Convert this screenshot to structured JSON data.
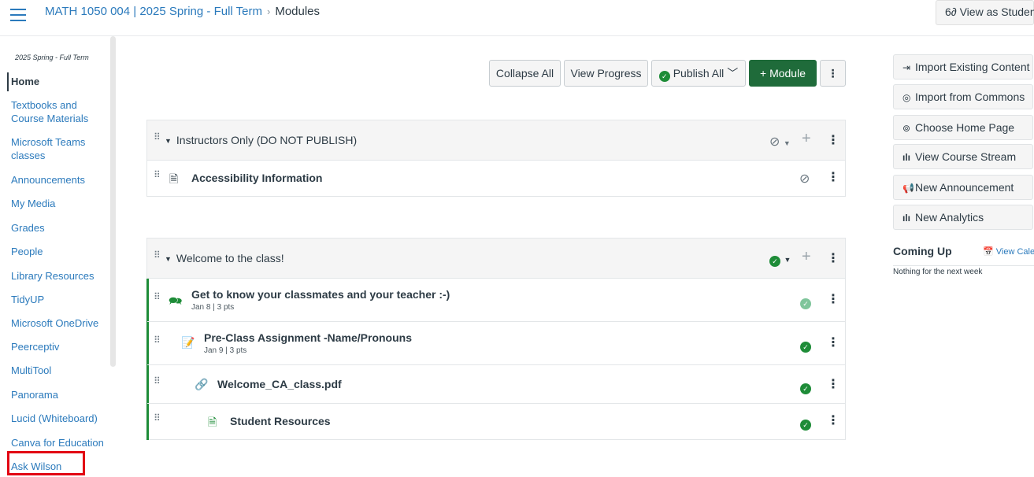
{
  "header": {
    "course": "MATH 1050 004 | 2025 Spring - Full Term",
    "separator": "›",
    "current": "Modules",
    "view_as_student": "View as Student"
  },
  "course_nav": {
    "term": "2025 Spring - Full Term",
    "items": [
      {
        "label": "Home"
      },
      {
        "label": "Textbooks and"
      },
      {
        "label": "Course Materials"
      },
      {
        "label": "Microsoft Teams"
      },
      {
        "label": "classes"
      },
      {
        "label": "Announcements"
      },
      {
        "label": "My Media"
      },
      {
        "label": "Grades"
      },
      {
        "label": "People"
      },
      {
        "label": "Library Resources"
      },
      {
        "label": "TidyUP"
      },
      {
        "label": "Microsoft OneDrive"
      },
      {
        "label": "Peerceptiv"
      },
      {
        "label": "MultiTool"
      },
      {
        "label": "Panorama"
      },
      {
        "label": "Lucid (Whiteboard)"
      },
      {
        "label": "Canva for Education"
      },
      {
        "label": "Ask Wilson"
      }
    ]
  },
  "toolbar": {
    "collapse_all": "Collapse All",
    "view_progress": "View Progress",
    "publish_all": "Publish All",
    "add_module": "+ Module",
    "more": "⋮"
  },
  "modules": [
    {
      "title": "Instructors Only (DO NOT PUBLISH)",
      "status": "unpublished",
      "items": [
        {
          "title": "Accessibility Information",
          "icon": "page-icon",
          "status": "unpublished",
          "meta": ""
        }
      ]
    },
    {
      "title": "Welcome to the class!",
      "status": "published",
      "items": [
        {
          "title": "Get to know your classmates and your teacher :-)",
          "icon": "discussion-icon",
          "status": "published-light",
          "meta": "Jan 8 | 3 pts"
        },
        {
          "title": "Pre-Class Assignment -Name/Pronouns",
          "icon": "assignment-icon",
          "status": "published",
          "meta": "Jan 9 | 3 pts"
        },
        {
          "title": "Welcome_CA_class.pdf",
          "icon": "attachment-icon",
          "status": "published",
          "meta": ""
        },
        {
          "title": "Student Resources",
          "icon": "page-icon",
          "status": "published",
          "meta": ""
        }
      ]
    }
  ],
  "sidebar": {
    "buttons": [
      {
        "label": "Import Existing Content",
        "icon": "import-icon"
      },
      {
        "label": "Import from Commons",
        "icon": "commons-icon"
      },
      {
        "label": "Choose Home Page",
        "icon": "target-icon"
      },
      {
        "label": "View Course Stream",
        "icon": "stream-icon"
      },
      {
        "label": "New Announcement",
        "icon": "announcement-icon"
      },
      {
        "label": "New Analytics",
        "icon": "analytics-icon"
      }
    ],
    "coming_up": "Coming Up",
    "view_calendar": "View Calendar",
    "nothing": "Nothing for the next week"
  },
  "colors": {
    "link": "#2b7abc",
    "published": "#1e8c38",
    "module_button": "#1f6b3a",
    "highlight": "#e20613"
  }
}
